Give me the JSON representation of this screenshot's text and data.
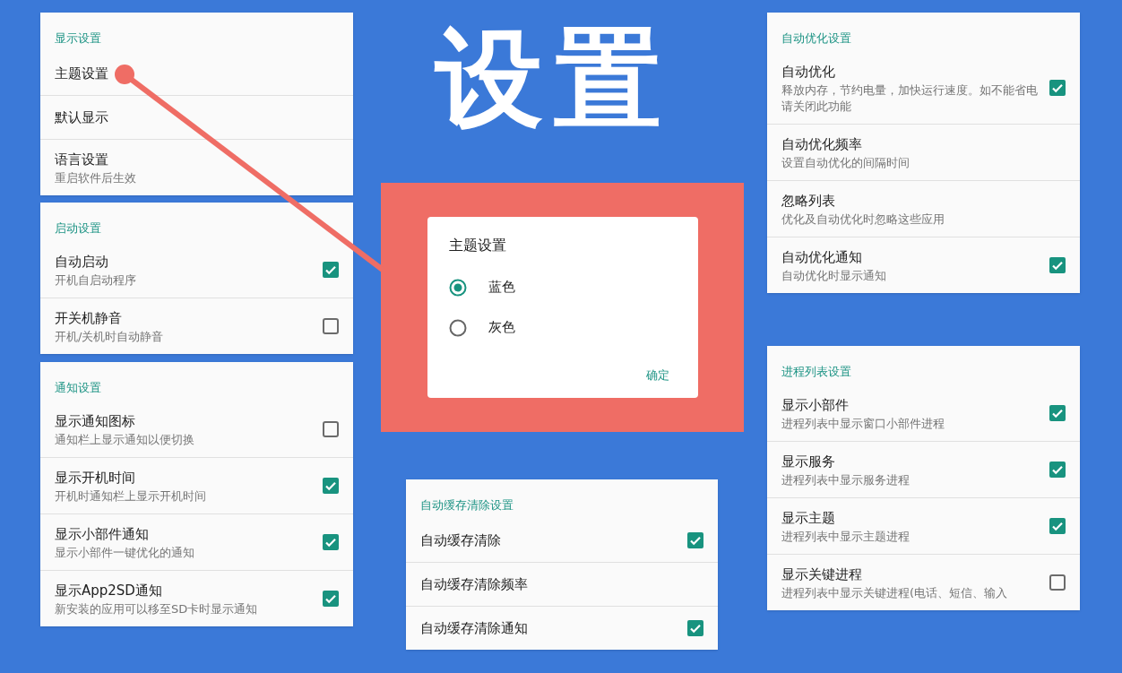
{
  "headline": "设置",
  "left_column": [
    {
      "title": "显示设置",
      "items": [
        {
          "label": "主题设置",
          "kind": "plain"
        },
        {
          "label": "默认显示",
          "kind": "plain"
        },
        {
          "label": "语言设置",
          "sub": "重启软件后生效",
          "kind": "plain"
        }
      ]
    },
    {
      "title": "启动设置",
      "items": [
        {
          "label": "自动启动",
          "sub": "开机自启动程序",
          "kind": "checkbox",
          "checked": true
        },
        {
          "label": "开关机静音",
          "sub": "开机/关机时自动静音",
          "kind": "checkbox",
          "checked": false
        }
      ]
    },
    {
      "title": "通知设置",
      "items": [
        {
          "label": "显示通知图标",
          "sub": "通知栏上显示通知以便切换",
          "kind": "checkbox",
          "checked": false
        },
        {
          "label": "显示开机时间",
          "sub": "开机时通知栏上显示开机时间",
          "kind": "checkbox",
          "checked": true
        },
        {
          "label": "显示小部件通知",
          "sub": "显示小部件一键优化的通知",
          "kind": "checkbox",
          "checked": true
        },
        {
          "label": "显示App2SD通知",
          "sub": "新安装的应用可以移至SD卡时显示通知",
          "kind": "checkbox",
          "checked": true
        }
      ]
    }
  ],
  "middle_column": [
    {
      "title": "自动缓存清除设置",
      "items": [
        {
          "label": "自动缓存清除",
          "kind": "checkbox",
          "checked": true
        },
        {
          "label": "自动缓存清除频率",
          "kind": "plain"
        },
        {
          "label": "自动缓存清除通知",
          "kind": "checkbox",
          "checked": true
        }
      ]
    }
  ],
  "right_column": [
    {
      "title": "自动优化设置",
      "items": [
        {
          "label": "自动优化",
          "sub": "释放内存，节约电量，加快运行速度。如不能省电请关闭此功能",
          "kind": "checkbox",
          "checked": true
        },
        {
          "label": "自动优化频率",
          "sub": "设置自动优化的间隔时间",
          "kind": "plain"
        },
        {
          "label": "忽略列表",
          "sub": "优化及自动优化时忽略这些应用",
          "kind": "plain"
        },
        {
          "label": "自动优化通知",
          "sub": "自动优化时显示通知",
          "kind": "checkbox",
          "checked": true
        }
      ]
    },
    {
      "title": "进程列表设置",
      "items": [
        {
          "label": "显示小部件",
          "sub": "进程列表中显示窗口小部件进程",
          "kind": "checkbox",
          "checked": true
        },
        {
          "label": "显示服务",
          "sub": "进程列表中显示服务进程",
          "kind": "checkbox",
          "checked": true
        },
        {
          "label": "显示主题",
          "sub": "进程列表中显示主题进程",
          "kind": "checkbox",
          "checked": true
        },
        {
          "label": "显示关键进程",
          "sub": "进程列表中显示关键进程(电话、短信、输入",
          "kind": "checkbox",
          "checked": false
        }
      ]
    }
  ],
  "dialog": {
    "title": "主题设置",
    "options": [
      {
        "label": "蓝色",
        "selected": true
      },
      {
        "label": "灰色",
        "selected": false
      }
    ],
    "confirm": "确定"
  }
}
